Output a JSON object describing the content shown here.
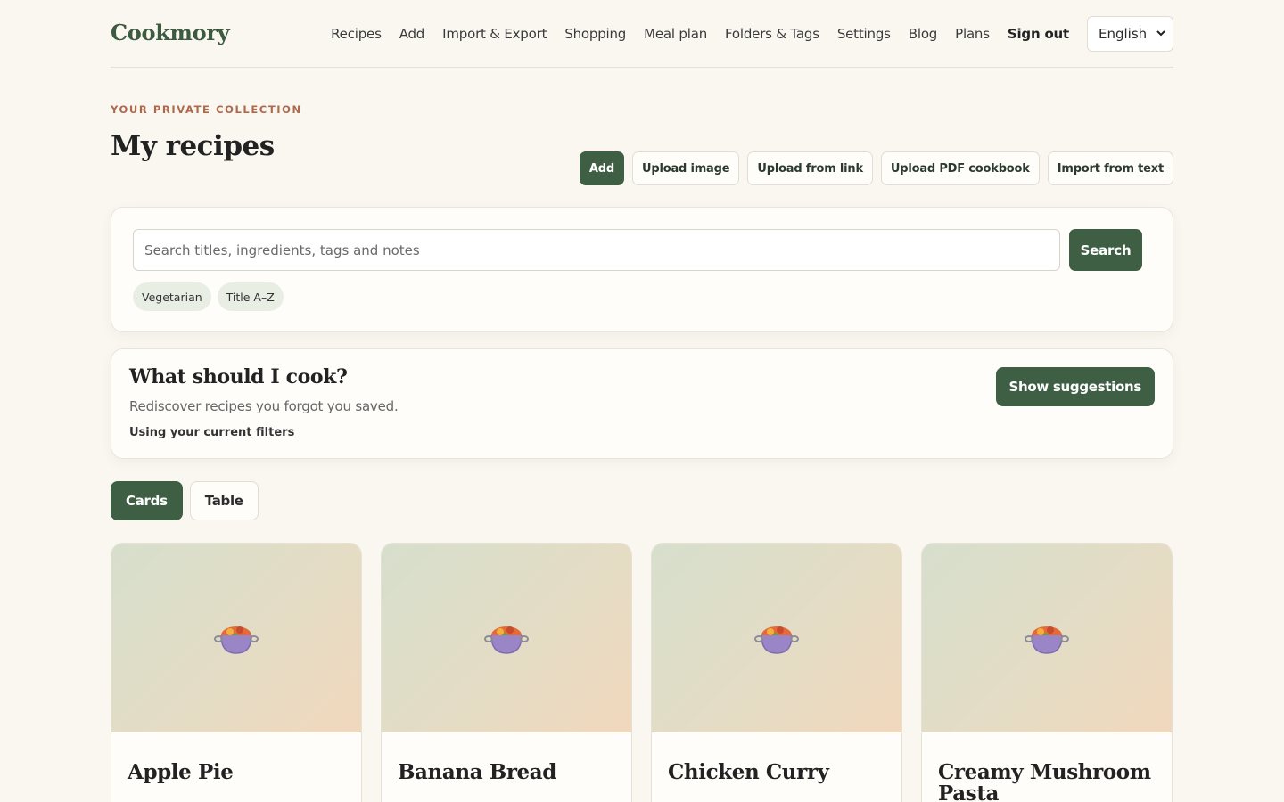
{
  "header": {
    "brand": "Cookmory",
    "nav": [
      {
        "label": "Recipes"
      },
      {
        "label": "Add"
      },
      {
        "label": "Import & Export"
      },
      {
        "label": "Shopping"
      },
      {
        "label": "Meal plan"
      },
      {
        "label": "Folders & Tags"
      },
      {
        "label": "Settings"
      },
      {
        "label": "Blog"
      },
      {
        "label": "Plans"
      },
      {
        "label": "Sign out"
      }
    ],
    "language": "English"
  },
  "page": {
    "eyebrow": "YOUR PRIVATE COLLECTION",
    "title": "My recipes",
    "actions": [
      {
        "label": "Add"
      },
      {
        "label": "Upload image"
      },
      {
        "label": "Upload from link"
      },
      {
        "label": "Upload PDF cookbook"
      },
      {
        "label": "Import from text"
      }
    ]
  },
  "search": {
    "placeholder": "Search titles, ingredients, tags and notes",
    "value": "",
    "button": "Search",
    "chips": [
      {
        "label": "Vegetarian"
      },
      {
        "label": "Title A–Z"
      }
    ]
  },
  "cook": {
    "title": "What should I cook?",
    "subtitle": "Rediscover recipes you forgot you saved.",
    "note": "Using your current filters",
    "button": "Show suggestions"
  },
  "view": {
    "options": [
      {
        "label": "Cards",
        "active": true
      },
      {
        "label": "Table",
        "active": false
      }
    ]
  },
  "recipes": [
    {
      "title": "Apple Pie",
      "icon": "cooking-pot-icon"
    },
    {
      "title": "Banana Bread",
      "icon": "cooking-pot-icon"
    },
    {
      "title": "Chicken Curry",
      "icon": "cooking-pot-icon"
    },
    {
      "title": "Creamy Mushroom Pasta",
      "icon": "cooking-pot-icon"
    }
  ],
  "colors": {
    "primary": "#3f5f45",
    "accent": "#b0684a",
    "background": "#faf7f1"
  }
}
